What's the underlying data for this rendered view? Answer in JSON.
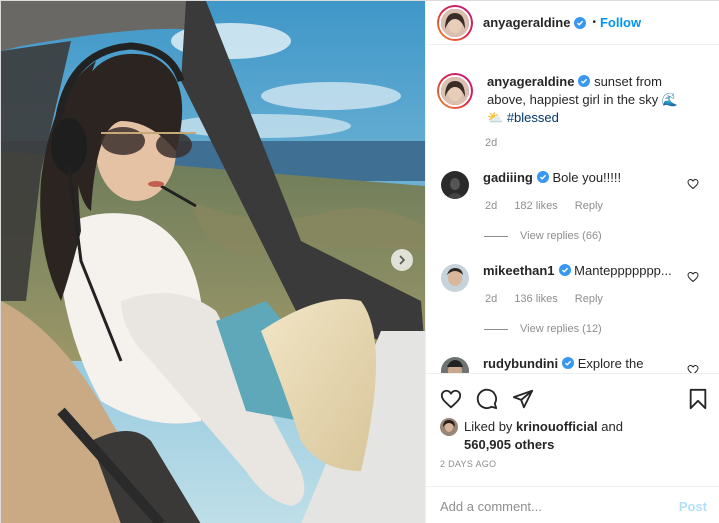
{
  "post": {
    "author": "anyageraldine",
    "follow_label": "Follow",
    "separator": "•",
    "caption_text": "sunset from above, happiest girl in the sky 🌊⛅",
    "caption_hashtag": "#blessed",
    "caption_time": "2d"
  },
  "comments": [
    {
      "user": "gadiiing",
      "text": "Bole you!!!!!",
      "time": "2d",
      "likes": "182 likes",
      "reply": "Reply",
      "view_replies": "View replies (66)"
    },
    {
      "user": "mikeethan1",
      "text": "Manteppppppp...",
      "time": "2d",
      "likes": "136 likes",
      "reply": "Reply",
      "view_replies": "View replies (12)"
    },
    {
      "user": "rudybundini",
      "text": "Explore the"
    }
  ],
  "likes": {
    "prefix": "Liked by",
    "user": "krinouofficial",
    "conj": "and",
    "count": "560,905 others"
  },
  "date": "2 DAYS AGO",
  "add_comment": {
    "placeholder": "Add a comment...",
    "post_label": "Post"
  },
  "colors": {
    "accent": "#0095f6",
    "verified": "#3897f0",
    "muted": "#8e8e8e"
  }
}
